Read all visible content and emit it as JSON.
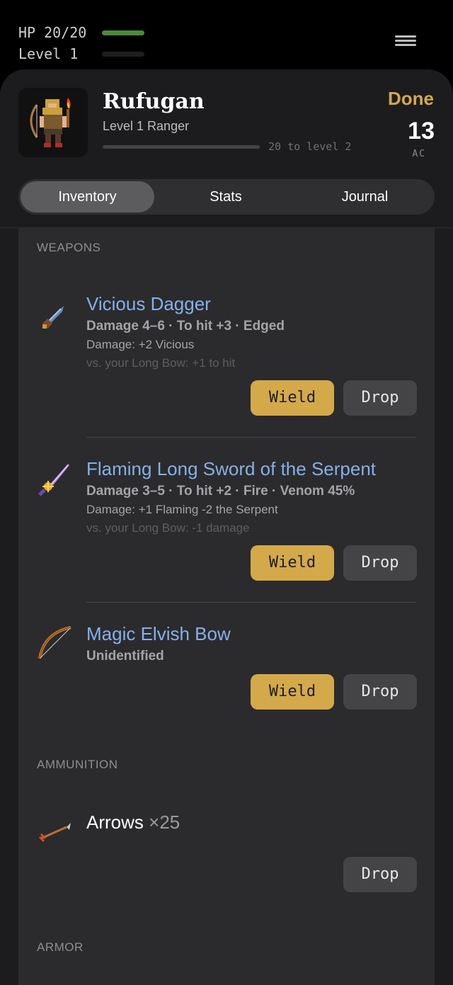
{
  "hud": {
    "hp_text": "HP 20/20",
    "level_text": "Level 1",
    "hp_fraction": 1.0,
    "xp_fraction": 0.0,
    "hp_color": "#4c8a3a"
  },
  "character": {
    "name": "Rufugan",
    "class_line": "Level 1 Ranger",
    "xp_text": "20 to level 2",
    "xp_fraction": 0.0,
    "done_label": "Done",
    "ac_value": "13",
    "ac_label": "AC"
  },
  "tabs": [
    {
      "label": "Inventory",
      "active": true
    },
    {
      "label": "Stats",
      "active": false
    },
    {
      "label": "Journal",
      "active": false
    }
  ],
  "inventory": {
    "sections": {
      "weapons": "WEAPONS",
      "ammunition": "AMMUNITION",
      "armor": "ARMOR"
    },
    "weapons": [
      {
        "icon": "dagger-icon",
        "name": "Vicious Dagger",
        "stats": "Damage 4–6  ·  To hit +3  ·  Edged",
        "sub": "Damage: +2 Vicious",
        "compare": "vs. your Long Bow: +1 to hit",
        "wield_label": "Wield",
        "drop_label": "Drop"
      },
      {
        "icon": "sword-icon",
        "name": "Flaming Long Sword of the Serpent",
        "stats": "Damage 3–5  ·  To hit +2  ·  Fire  ·  Venom 45%",
        "sub": "Damage: +1 Flaming -2 the Serpent",
        "compare": "vs. your Long Bow: -1 damage",
        "wield_label": "Wield",
        "drop_label": "Drop"
      },
      {
        "icon": "bow-icon",
        "name": "Magic Elvish Bow",
        "stats": "Unidentified",
        "wield_label": "Wield",
        "drop_label": "Drop"
      }
    ],
    "ammunition": [
      {
        "icon": "arrow-icon",
        "name": "Arrows",
        "quantity": "×25",
        "drop_label": "Drop"
      }
    ]
  },
  "colors": {
    "accent": "#d4a94a",
    "item_name": "#86b0e8",
    "background": "#1c1c1e"
  }
}
